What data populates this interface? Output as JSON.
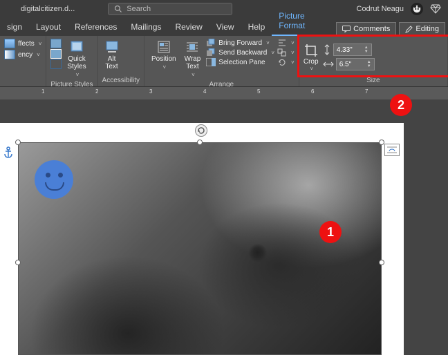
{
  "titlebar": {
    "doc": "digitalcitizen.d...",
    "search_placeholder": "Search",
    "user": "Codrut Neagu"
  },
  "tabs": {
    "items": [
      "sign",
      "Layout",
      "References",
      "Mailings",
      "Review",
      "View",
      "Help",
      "Picture Format"
    ],
    "active": 7,
    "comments": "Comments",
    "editing": "Editing"
  },
  "ribbon": {
    "effects": "ffects",
    "ency": "ency",
    "styles": {
      "quick": "Quick\nStyles",
      "group": "Picture Styles"
    },
    "acc": {
      "alt": "Alt\nText",
      "group": "Accessibility"
    },
    "arrange": {
      "position": "Position",
      "wrap": "Wrap\nText",
      "bring": "Bring Forward",
      "send": "Send Backward",
      "sel": "Selection Pane",
      "group": "Arrange"
    },
    "size": {
      "crop": "Crop",
      "height": "4.33\"",
      "width": "6.5\"",
      "group": "Size"
    }
  },
  "ruler": [
    "1",
    "2",
    "3",
    "4",
    "5",
    "6",
    "7"
  ],
  "callouts": {
    "one": "1",
    "two": "2"
  }
}
